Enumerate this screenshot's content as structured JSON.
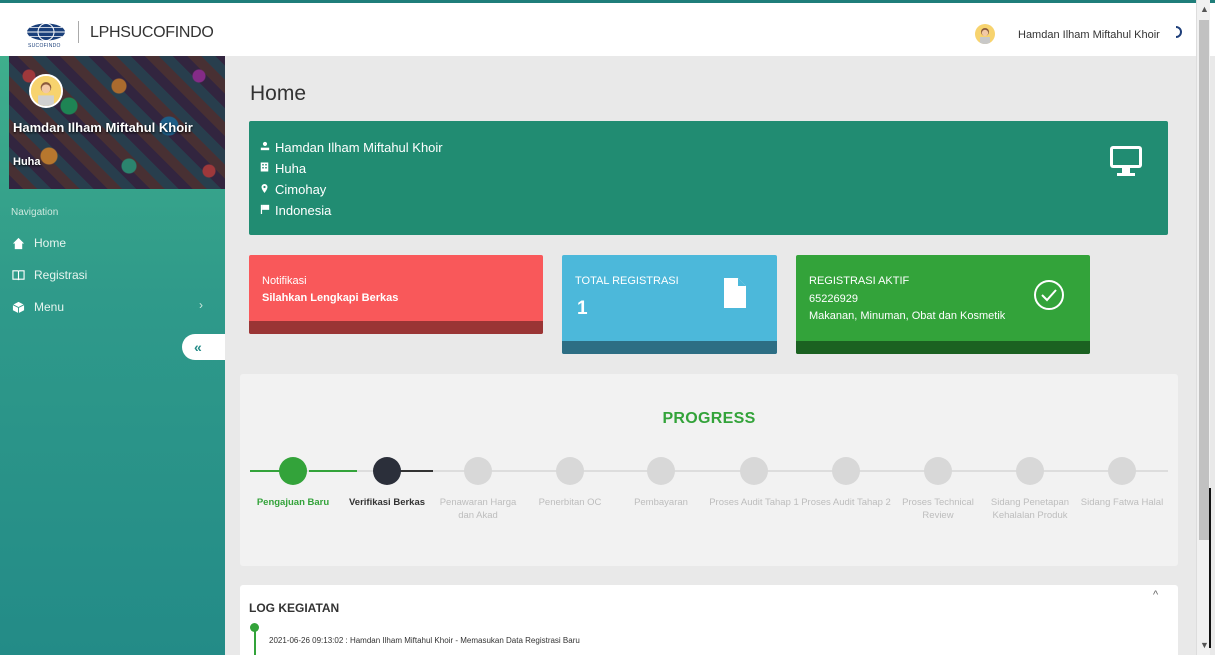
{
  "topbar": {
    "logo_sub": "SUCOFINDO",
    "brand_bold": "LPH",
    "brand_rest": "SUCOFINDO",
    "user_name": "Hamdan Ilham Miftahul Khoir"
  },
  "sidebar": {
    "profile_name": "Hamdan Ilham Miftahul Khoir",
    "profile_org": "Huha",
    "nav_label": "Navigation",
    "items": [
      {
        "label": "Home",
        "icon": "home-icon"
      },
      {
        "label": "Registrasi",
        "icon": "book-icon"
      },
      {
        "label": "Menu",
        "icon": "cube-icon"
      }
    ]
  },
  "main": {
    "page_title": "Home",
    "profile": {
      "name": "Hamdan Ilham Miftahul Khoir",
      "org": "Huha",
      "city": "Cimohay",
      "country": "Indonesia"
    },
    "notif": {
      "title": "Notifikasi",
      "message": "Silahkan Lengkapi Berkas"
    },
    "total": {
      "title": "TOTAL REGISTRASI",
      "value": "1"
    },
    "aktif": {
      "title": "REGISTRASI AKTIF",
      "id": "65226929",
      "category": "Makanan, Minuman, Obat dan Kosmetik"
    },
    "progress": {
      "title": "PROGRESS",
      "steps": [
        {
          "label": "Pengajuan Baru",
          "state": "done"
        },
        {
          "label": "Verifikasi Berkas",
          "state": "current"
        },
        {
          "label": "Penawaran Harga dan Akad",
          "state": "pending"
        },
        {
          "label": "Penerbitan OC",
          "state": "pending"
        },
        {
          "label": "Pembayaran",
          "state": "pending"
        },
        {
          "label": "Proses Audit Tahap 1",
          "state": "pending"
        },
        {
          "label": "Proses Audit Tahap 2",
          "state": "pending"
        },
        {
          "label": "Proses Technical Review",
          "state": "pending"
        },
        {
          "label": "Sidang Penetapan Kehalalan Produk",
          "state": "pending"
        },
        {
          "label": "Sidang Fatwa Halal",
          "state": "pending"
        }
      ]
    },
    "log": {
      "title": "LOG KEGIATAN",
      "entries": [
        "2021-06-26 09:13:02 : Hamdan Ilham Miftahul Khoir - Memasukan Data Registrasi Baru"
      ]
    }
  },
  "colors": {
    "accent_green": "#33a33a",
    "sidebar_teal": "#238b87",
    "profile_card": "#218c72",
    "notif_red": "#f9585a",
    "total_blue": "#4cb8da"
  }
}
